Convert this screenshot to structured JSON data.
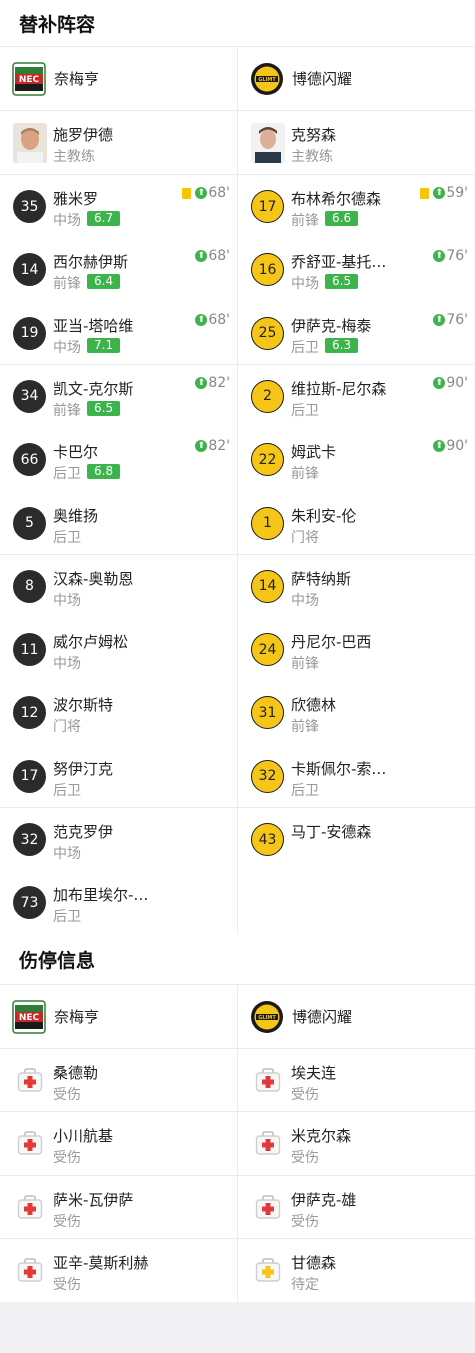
{
  "subs_section": {
    "title": "替补阵容",
    "home_team": "奈梅亨",
    "away_team": "博德闪耀",
    "home_coach": {
      "name": "施罗伊德",
      "role": "主教练"
    },
    "away_coach": {
      "name": "克努森",
      "role": "主教练"
    },
    "home_players": [
      {
        "number": "35",
        "name": "雅米罗",
        "position": "中场",
        "rating": "6.7",
        "sub_time": "68'",
        "yellow_card": true
      },
      {
        "number": "14",
        "name": "西尔赫伊斯",
        "position": "前锋",
        "rating": "6.4",
        "sub_time": "68'"
      },
      {
        "number": "19",
        "name": "亚当-塔哈维",
        "position": "中场",
        "rating": "7.1",
        "sub_time": "68'"
      },
      {
        "number": "34",
        "name": "凯文-克尔斯",
        "position": "前锋",
        "rating": "6.5",
        "sub_time": "82'"
      },
      {
        "number": "66",
        "name": "卡巴尔",
        "position": "后卫",
        "rating": "6.8",
        "sub_time": "82'"
      },
      {
        "number": "5",
        "name": "奥维扬",
        "position": "后卫"
      },
      {
        "number": "8",
        "name": "汉森-奥勒恩",
        "position": "中场"
      },
      {
        "number": "11",
        "name": "威尔卢姆松",
        "position": "中场"
      },
      {
        "number": "12",
        "name": "波尔斯特",
        "position": "门将"
      },
      {
        "number": "17",
        "name": "努伊汀克",
        "position": "后卫"
      },
      {
        "number": "32",
        "name": "范克罗伊",
        "position": "中场"
      },
      {
        "number": "73",
        "name": "加布里埃尔-…",
        "position": "后卫"
      }
    ],
    "away_players": [
      {
        "number": "17",
        "name": "布林希尔德森",
        "position": "前锋",
        "rating": "6.6",
        "sub_time": "59'",
        "yellow_card": true
      },
      {
        "number": "16",
        "name": "乔舒亚-基托…",
        "position": "中场",
        "rating": "6.5",
        "sub_time": "76'"
      },
      {
        "number": "25",
        "name": "伊萨克-梅泰",
        "position": "后卫",
        "rating": "6.3",
        "sub_time": "76'"
      },
      {
        "number": "2",
        "name": "维拉斯-尼尔森",
        "position": "后卫",
        "sub_time": "90'"
      },
      {
        "number": "22",
        "name": "姆武卡",
        "position": "前锋",
        "sub_time": "90'"
      },
      {
        "number": "1",
        "name": "朱利安-伦",
        "position": "门将"
      },
      {
        "number": "14",
        "name": "萨特纳斯",
        "position": "中场"
      },
      {
        "number": "24",
        "name": "丹尼尔-巴西",
        "position": "前锋"
      },
      {
        "number": "31",
        "name": "欣德林",
        "position": "前锋"
      },
      {
        "number": "32",
        "name": "卡斯佩尔-索…",
        "position": "后卫"
      },
      {
        "number": "43",
        "name": "马丁-安德森",
        "position": ""
      }
    ]
  },
  "injury_section": {
    "title": "伤停信息",
    "home_team": "奈梅亨",
    "away_team": "博德闪耀",
    "home_players": [
      {
        "name": "桑德勒",
        "status": "受伤",
        "icon": "first-aid-kit-red-icon"
      },
      {
        "name": "小川航基",
        "status": "受伤",
        "icon": "first-aid-kit-red-icon"
      },
      {
        "name": "萨米-瓦伊萨",
        "status": "受伤",
        "icon": "first-aid-kit-red-icon"
      },
      {
        "name": "亚辛-莫斯利赫",
        "status": "受伤",
        "icon": "first-aid-kit-red-icon"
      }
    ],
    "away_players": [
      {
        "name": "埃夫连",
        "status": "受伤",
        "icon": "first-aid-kit-red-icon"
      },
      {
        "name": "米克尔森",
        "status": "受伤",
        "icon": "first-aid-kit-red-icon"
      },
      {
        "name": "伊萨克-雄",
        "status": "受伤",
        "icon": "first-aid-kit-red-icon"
      },
      {
        "name": "甘德森",
        "status": "待定",
        "icon": "first-aid-kit-yellow-icon"
      }
    ]
  },
  "colors": {
    "rating_bg": "#3cb44b",
    "home_badge": "#2b2b2b",
    "away_badge": "#f5c518",
    "injured_cross": "#e03a3a",
    "doubtful_cross": "#f5c518"
  }
}
